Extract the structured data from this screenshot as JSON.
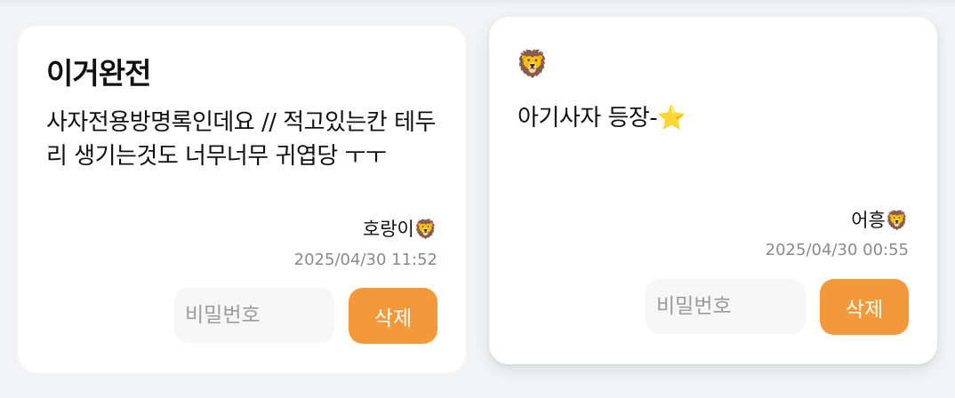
{
  "guestbook": {
    "entries": [
      {
        "title": "이거완전",
        "body": "사자전용방명록인데요 // 적고있는칸 테두리 생기는것도 너무너무 귀엽당 ㅜㅜ",
        "author": "호랑이🦁",
        "timestamp": "2025/04/30 11:52",
        "password_placeholder": "비밀번호",
        "delete_label": "삭제"
      },
      {
        "title": "🦁",
        "body": "아기사자 등장-⭐",
        "author": "어흥🦁",
        "timestamp": "2025/04/30 00:55",
        "password_placeholder": "비밀번호",
        "delete_label": "삭제"
      }
    ]
  },
  "colors": {
    "page_background": "#f2f3f5",
    "card_background": "#ffffff",
    "delete_button": "#f3993b",
    "input_background": "#f6f6f6",
    "timestamp_text": "#8a8a8a"
  }
}
